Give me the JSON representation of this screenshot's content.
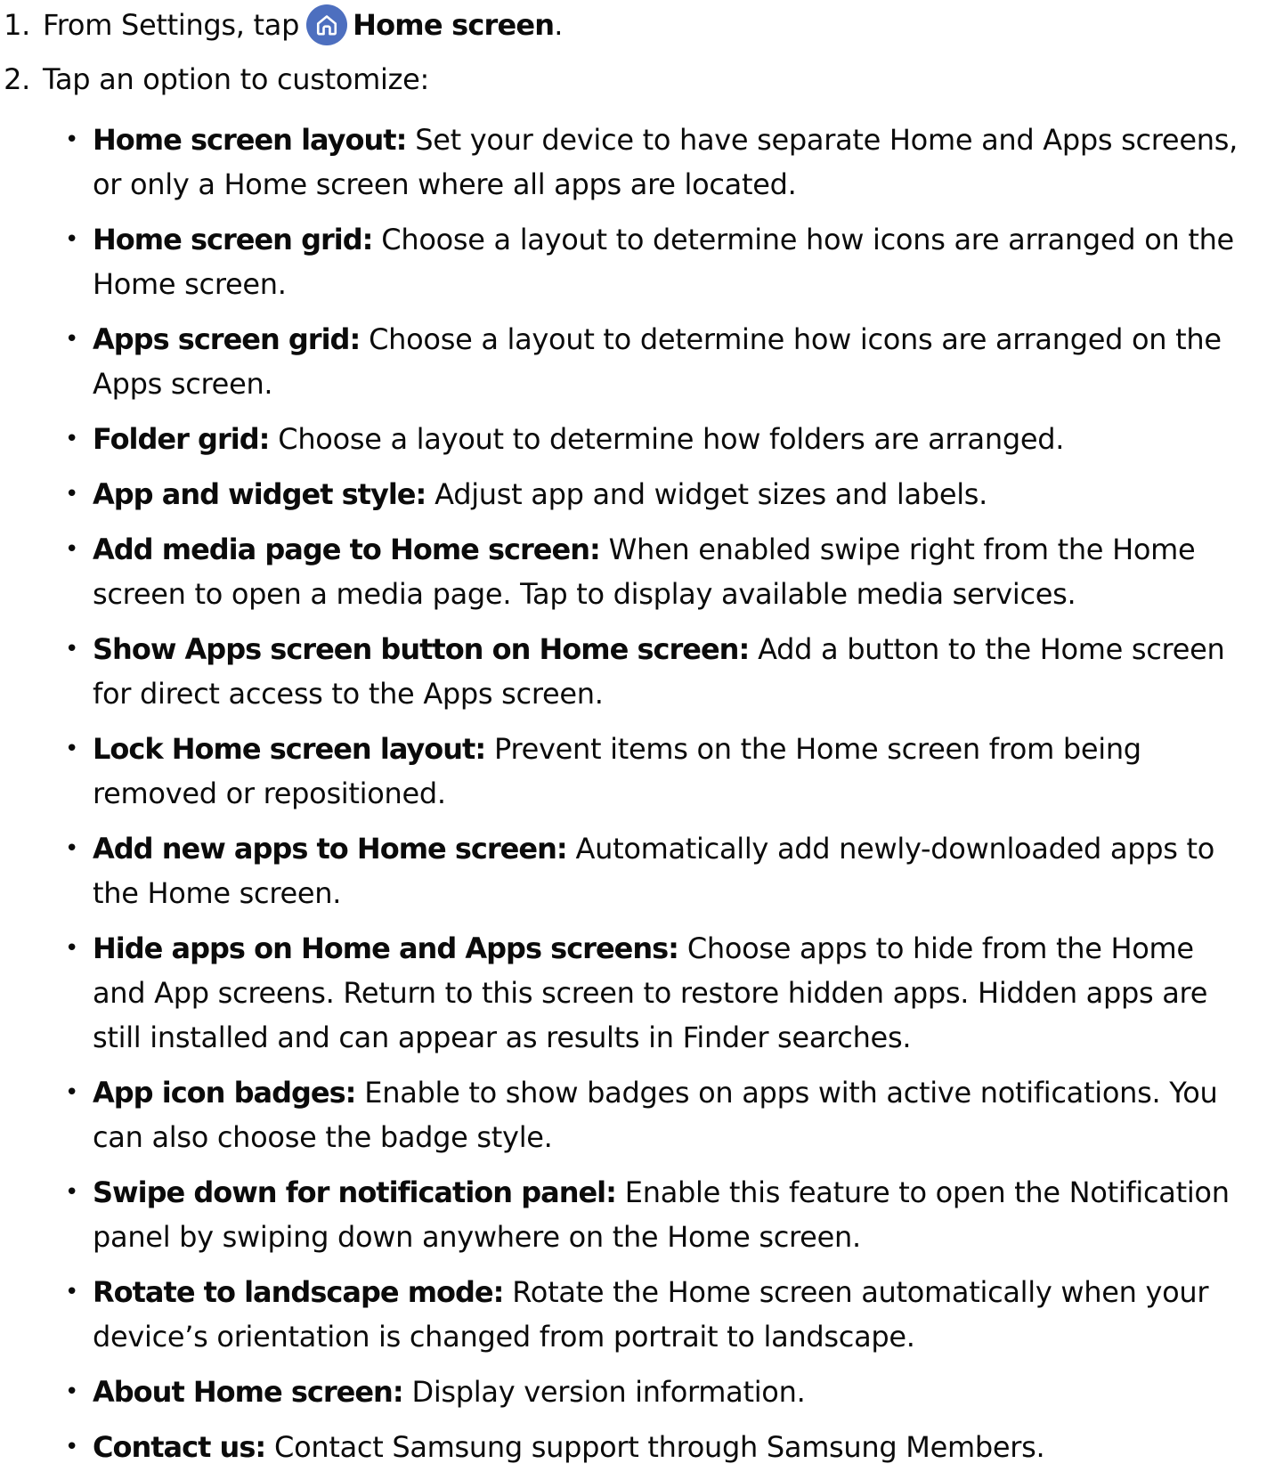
{
  "steps": [
    {
      "number": "1.",
      "text_before": "From Settings, tap",
      "icon": "home-icon",
      "bold": "Home screen",
      "text_after": "."
    },
    {
      "number": "2.",
      "text": "Tap an option to customize:"
    }
  ],
  "options": [
    {
      "term": "Home screen layout:",
      "desc": " Set your device to have separate Home and Apps screens, or only a Home screen where all apps are located."
    },
    {
      "term": "Home screen grid:",
      "desc": " Choose a layout to determine how icons are arranged on the Home screen."
    },
    {
      "term": "Apps screen grid:",
      "desc": " Choose a layout to determine how icons are arranged on the Apps screen."
    },
    {
      "term": "Folder grid:",
      "desc": " Choose a layout to determine how folders are arranged."
    },
    {
      "term": "App and widget style:",
      "desc": " Adjust app and widget sizes and labels."
    },
    {
      "term": "Add media page to Home screen:",
      "desc": " When enabled swipe right from the Home screen to open a media page. Tap to display available media services."
    },
    {
      "term": "Show Apps screen button on Home screen:",
      "desc": " Add a button to the Home screen for direct access to the Apps screen."
    },
    {
      "term": "Lock Home screen layout:",
      "desc": " Prevent items on the Home screen from being removed or repositioned."
    },
    {
      "term": "Add new apps to Home screen:",
      "desc": " Automatically add newly-downloaded apps to the Home screen."
    },
    {
      "term": "Hide apps on Home and Apps screens:",
      "desc": " Choose apps to hide from the Home and App screens. Return to this screen to restore hidden apps. Hidden apps are still installed and can appear as results in Finder searches."
    },
    {
      "term": "App icon badges:",
      "desc": " Enable to show badges on apps with active notifications. You can also choose the badge style."
    },
    {
      "term": "Swipe down for notification panel:",
      "desc": " Enable this feature to open the Notification panel by swiping down anywhere on the Home screen."
    },
    {
      "term": "Rotate to landscape mode:",
      "desc": " Rotate the Home screen automatically when your device’s orientation is changed from portrait to landscape."
    },
    {
      "term": "About Home screen:",
      "desc": " Display version information."
    },
    {
      "term": "Contact us:",
      "desc": " Contact Samsung support through Samsung Members."
    }
  ],
  "colors": {
    "text": "#0b0b0b",
    "icon_badge": "#4d6fbf"
  }
}
